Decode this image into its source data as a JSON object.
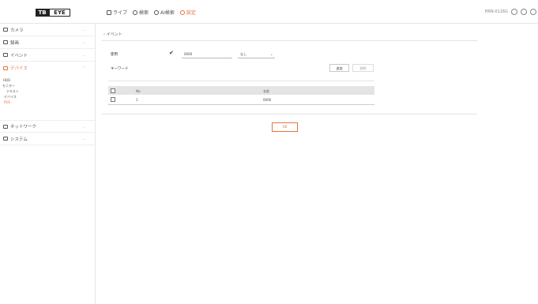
{
  "header": {
    "logo_tb": "TB",
    "logo_eye": "EYE",
    "nav": [
      {
        "label": "ライブ",
        "icon": "monitor-icon"
      },
      {
        "label": "検索",
        "icon": "search-icon"
      },
      {
        "label": "AI検索",
        "icon": "ai-search-icon"
      },
      {
        "label": "設定",
        "icon": "gear-icon"
      }
    ],
    "device_label": "HRN-0116G",
    "right_icons": [
      "user-icon",
      "help-icon",
      "power-icon"
    ]
  },
  "sidebar": {
    "items": [
      {
        "label": "カメラ",
        "icon": "camera-icon"
      },
      {
        "label": "録画",
        "icon": "record-icon"
      },
      {
        "label": "イベント",
        "icon": "bell-icon"
      },
      {
        "label": "デバイス",
        "icon": "device-icon"
      },
      {
        "label": "ネットワーク",
        "icon": "network-icon"
      },
      {
        "label": "システム",
        "icon": "system-icon"
      }
    ],
    "subitems": [
      "HDD",
      "モニター",
      "テキスト",
      "デバイス",
      "POS"
    ]
  },
  "main": {
    "breadcrumb": "イベント",
    "enable_label": "使用",
    "enable_checked": true,
    "field_value": "0000",
    "select_value": "なし",
    "keyword_label": "キーワード",
    "add_button": "追加",
    "delete_button": "削除",
    "table": {
      "headers": [
        "No.",
        "名前"
      ],
      "rows": [
        {
          "no": "1",
          "name": "0000"
        }
      ]
    },
    "ok_button": "OK"
  },
  "colors": {
    "accent": "#e8743b",
    "table_header": "#e4e4e4"
  }
}
